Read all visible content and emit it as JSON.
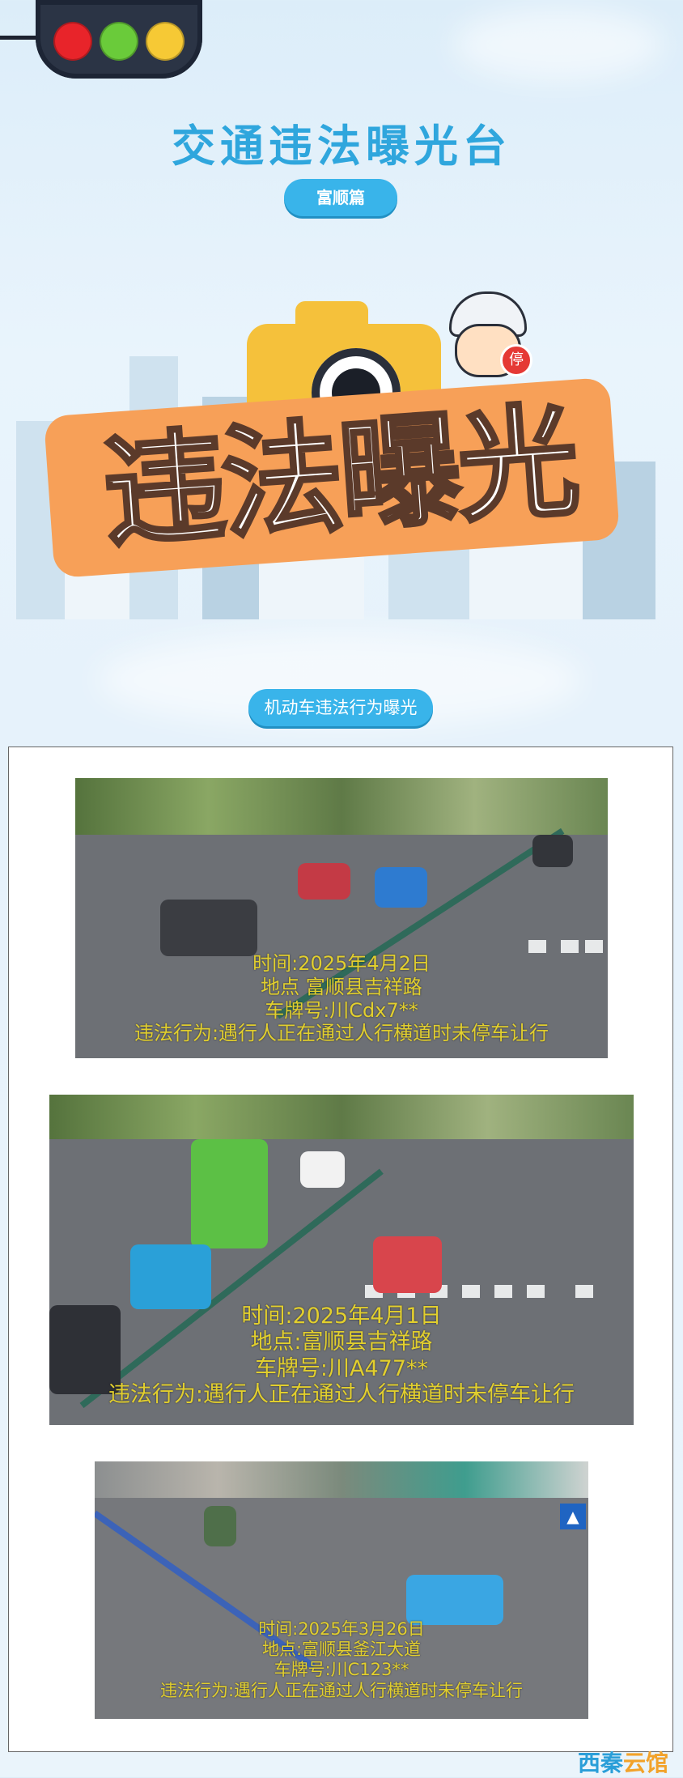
{
  "header": {
    "title": "交通违法曝光台",
    "subtitle_pill": "富顺篇",
    "traffic_light_colors": [
      "#e8242a",
      "#6acb3a",
      "#f6c935"
    ]
  },
  "banner": {
    "slogan": "违法曝光",
    "cop_sign": "停"
  },
  "section": {
    "label": "机动车违法行为曝光"
  },
  "violations": [
    {
      "time": "时间:2025年4月2日",
      "place": "地点 富顺县吉祥路",
      "plate": "车牌号:川Cdx7**",
      "behavior": "违法行为:遇行人正在通过人行横道时未停车让行"
    },
    {
      "time": "时间:2025年4月1日",
      "place": "地点:富顺县吉祥路",
      "plate": "车牌号:川A477**",
      "behavior": "违法行为:遇行人正在通过人行横道时未停车让行"
    },
    {
      "time": "时间:2025年3月26日",
      "place": "地点:富顺县釜江大道",
      "plate": "车牌号:川C123**",
      "behavior": "违法行为:遇行人正在通过人行横道时未停车让行"
    }
  ],
  "watermark": {
    "part1": "西秦",
    "part2": "云馆"
  }
}
